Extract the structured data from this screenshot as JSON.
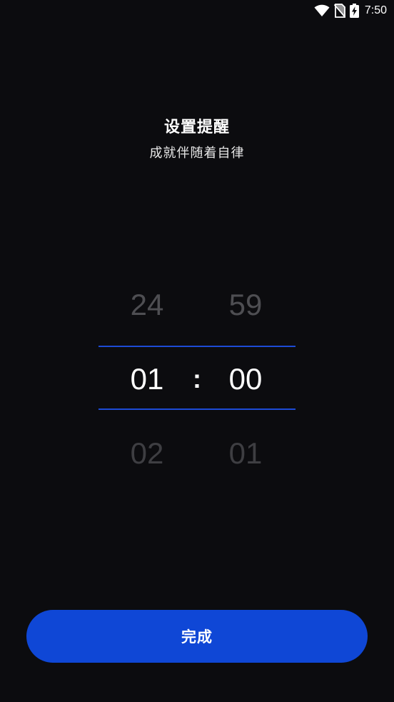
{
  "status_bar": {
    "time": "7:50",
    "icons": [
      "wifi-icon",
      "no-sim-icon",
      "battery-charging-icon"
    ]
  },
  "header": {
    "title": "设置提醒",
    "subtitle": "成就伴随着自律"
  },
  "time_picker": {
    "hours": {
      "prev": "24",
      "current": "01",
      "next": "02"
    },
    "separator": ":",
    "minutes": {
      "prev": "59",
      "current": "00",
      "next": "01"
    },
    "accent_color": "#1d4bd6"
  },
  "footer": {
    "done_label": "完成",
    "button_color": "#0f47d6"
  }
}
